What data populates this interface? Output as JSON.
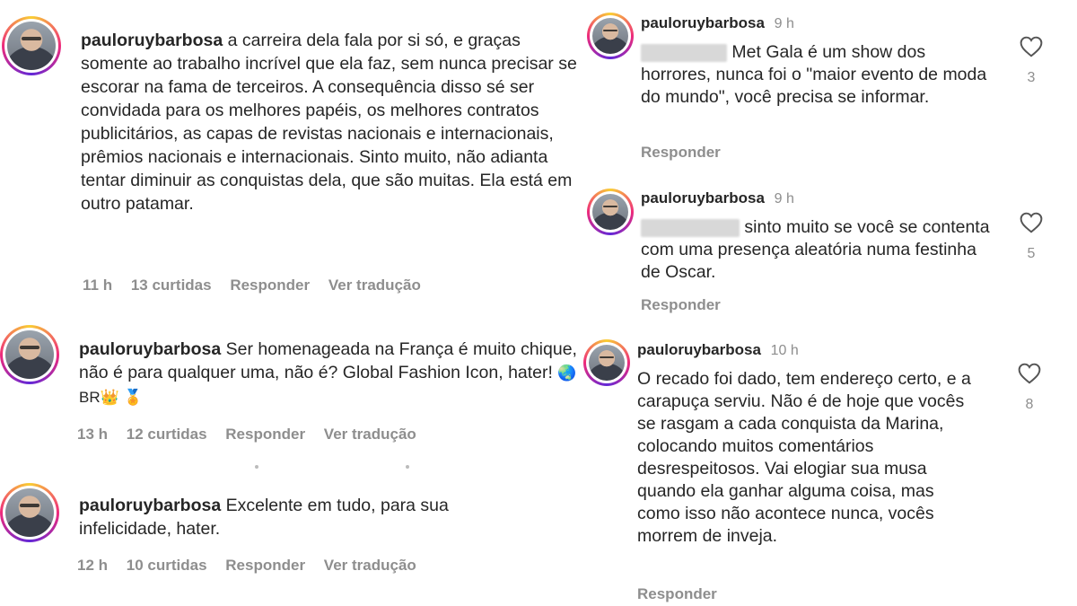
{
  "left_comments": [
    {
      "username": "pauloruybarbosa",
      "text": "a carreira dela fala por si só, e graças somente ao trabalho incrível que ela faz, sem nunca precisar se escorar na fama de terceiros. A consequência disso sé ser convidada para os melhores papéis, os melhores contratos publicitários, as capas de revistas nacionais e internacionais, prêmios nacionais e internacionais. Sinto muito, não adianta tentar diminuir as conquistas dela, que são muitas. Ela está em outro patamar.",
      "time": "11 h",
      "likes": "13 curtidas",
      "reply": "Responder",
      "translate": "Ver tradução"
    },
    {
      "username": "pauloruybarbosa",
      "text": "Ser homenageada na França é muito chique, não é para qualquer uma, não é? Global Fashion Icon, hater!",
      "emoji": "🌏 BR👑 🏅",
      "time": "13 h",
      "likes": "12 curtidas",
      "reply": "Responder",
      "translate": "Ver tradução"
    },
    {
      "username": "pauloruybarbosa",
      "text": "Excelente em tudo, para sua infelicidade, hater.",
      "time": "12 h",
      "likes": "10 curtidas",
      "reply": "Responder",
      "translate": "Ver tradução"
    }
  ],
  "right_comments": [
    {
      "username": "pauloruybarbosa",
      "time": "9 h",
      "text": "Met Gala é um show dos horrores, nunca foi o \"maior evento de moda do mundo\", você precisa se informar.",
      "reply": "Responder",
      "like_count": "3"
    },
    {
      "username": "pauloruybarbosa",
      "time": "9 h",
      "text": "sinto muito se você se contenta com uma presença aleatória numa festinha de Oscar.",
      "reply": "Responder",
      "like_count": "5"
    },
    {
      "username": "pauloruybarbosa",
      "time": "10 h",
      "text": "O recado foi dado, tem endereço certo, e a carapuça serviu. Não é de hoje que vocês se rasgam a cada conquista da Marina, colocando muitos comentários desrespeitosos. Vai elogiar sua musa quando ela ganhar alguma coisa, mas como isso não acontece nunca, vocês morrem de inveja.",
      "reply": "Responder",
      "like_count": "8"
    }
  ],
  "icons": {
    "like": "heart-outline-icon",
    "avatar": "profile-avatar"
  },
  "colors": {
    "text": "#262626",
    "muted": "#8e8e8e",
    "ring_start": "#f9ce34",
    "ring_mid": "#ee2a7b"
  }
}
